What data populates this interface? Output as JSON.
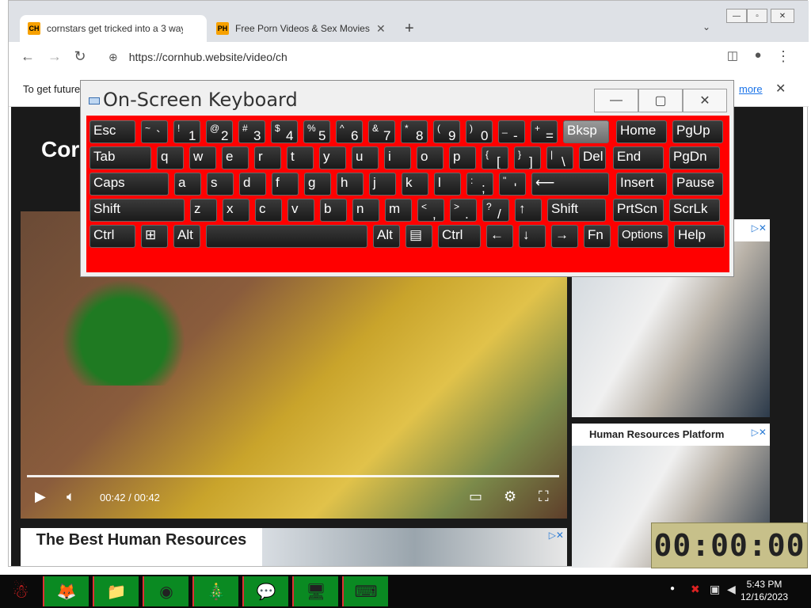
{
  "browser": {
    "tabs": [
      {
        "favicon": "CH",
        "title": "cornstars get tricked into a 3 way",
        "active": true
      },
      {
        "favicon": "PH",
        "title": "Free Porn Videos & Sex Movies -",
        "active": false
      }
    ],
    "url": "https://cornhub.website/video/ch",
    "infobar_text": "To get future",
    "infobar_link": "more"
  },
  "page": {
    "logo": "Cor",
    "video_time": "00:42 / 00:42",
    "side_ads": [
      "",
      "Human Resources Platform"
    ],
    "bottom_ad": "The Best Human Resources"
  },
  "osk": {
    "title": "On-Screen Keyboard",
    "rows": [
      [
        [
          "Esc",
          ""
        ],
        [
          "`",
          "~"
        ],
        [
          "1",
          "!"
        ],
        [
          "2",
          "@"
        ],
        [
          "3",
          "#"
        ],
        [
          "4",
          "$"
        ],
        [
          "5",
          "%"
        ],
        [
          "6",
          "^"
        ],
        [
          "7",
          "&"
        ],
        [
          "8",
          "*"
        ],
        [
          "9",
          "("
        ],
        [
          "0",
          ")"
        ],
        [
          "-",
          "_"
        ],
        [
          "=",
          "+"
        ],
        [
          "Bksp",
          ""
        ],
        [
          "Home",
          ""
        ],
        [
          "PgUp",
          ""
        ]
      ],
      [
        [
          "Tab",
          ""
        ],
        [
          "q",
          ""
        ],
        [
          "w",
          ""
        ],
        [
          "e",
          ""
        ],
        [
          "r",
          ""
        ],
        [
          "t",
          ""
        ],
        [
          "y",
          ""
        ],
        [
          "u",
          ""
        ],
        [
          "i",
          ""
        ],
        [
          "o",
          ""
        ],
        [
          "p",
          ""
        ],
        [
          "[",
          "{"
        ],
        [
          "]",
          "}"
        ],
        [
          "\\",
          "|"
        ],
        [
          "Del",
          ""
        ],
        [
          "End",
          ""
        ],
        [
          "PgDn",
          ""
        ]
      ],
      [
        [
          "Caps",
          ""
        ],
        [
          "a",
          ""
        ],
        [
          "s",
          ""
        ],
        [
          "d",
          ""
        ],
        [
          "f",
          ""
        ],
        [
          "g",
          ""
        ],
        [
          "h",
          ""
        ],
        [
          "j",
          ""
        ],
        [
          "k",
          ""
        ],
        [
          "l",
          ""
        ],
        [
          ";",
          ":"
        ],
        [
          "'",
          "\""
        ],
        [
          "⟵",
          ""
        ],
        [
          "Insert",
          ""
        ],
        [
          "Pause",
          ""
        ]
      ],
      [
        [
          "Shift",
          ""
        ],
        [
          "z",
          ""
        ],
        [
          "x",
          ""
        ],
        [
          "c",
          ""
        ],
        [
          "v",
          ""
        ],
        [
          "b",
          ""
        ],
        [
          "n",
          ""
        ],
        [
          "m",
          ""
        ],
        [
          ",",
          "<"
        ],
        [
          ".",
          ">"
        ],
        [
          "/",
          "?"
        ],
        [
          "↑",
          ""
        ],
        [
          "Shift",
          ""
        ],
        [
          "PrtScn",
          ""
        ],
        [
          "ScrLk",
          ""
        ]
      ],
      [
        [
          "Ctrl",
          ""
        ],
        [
          "⊞",
          ""
        ],
        [
          "Alt",
          ""
        ],
        [
          "",
          ""
        ],
        [
          "Alt",
          ""
        ],
        [
          "▤",
          ""
        ],
        [
          "Ctrl",
          ""
        ],
        [
          "←",
          ""
        ],
        [
          "↓",
          ""
        ],
        [
          "→",
          ""
        ],
        [
          "Fn",
          ""
        ],
        [
          "Options",
          ""
        ],
        [
          "Help",
          ""
        ]
      ]
    ]
  },
  "taskbar": {
    "time": "5:43 PM",
    "date": "12/16/2023"
  },
  "timer": "00:00:00"
}
